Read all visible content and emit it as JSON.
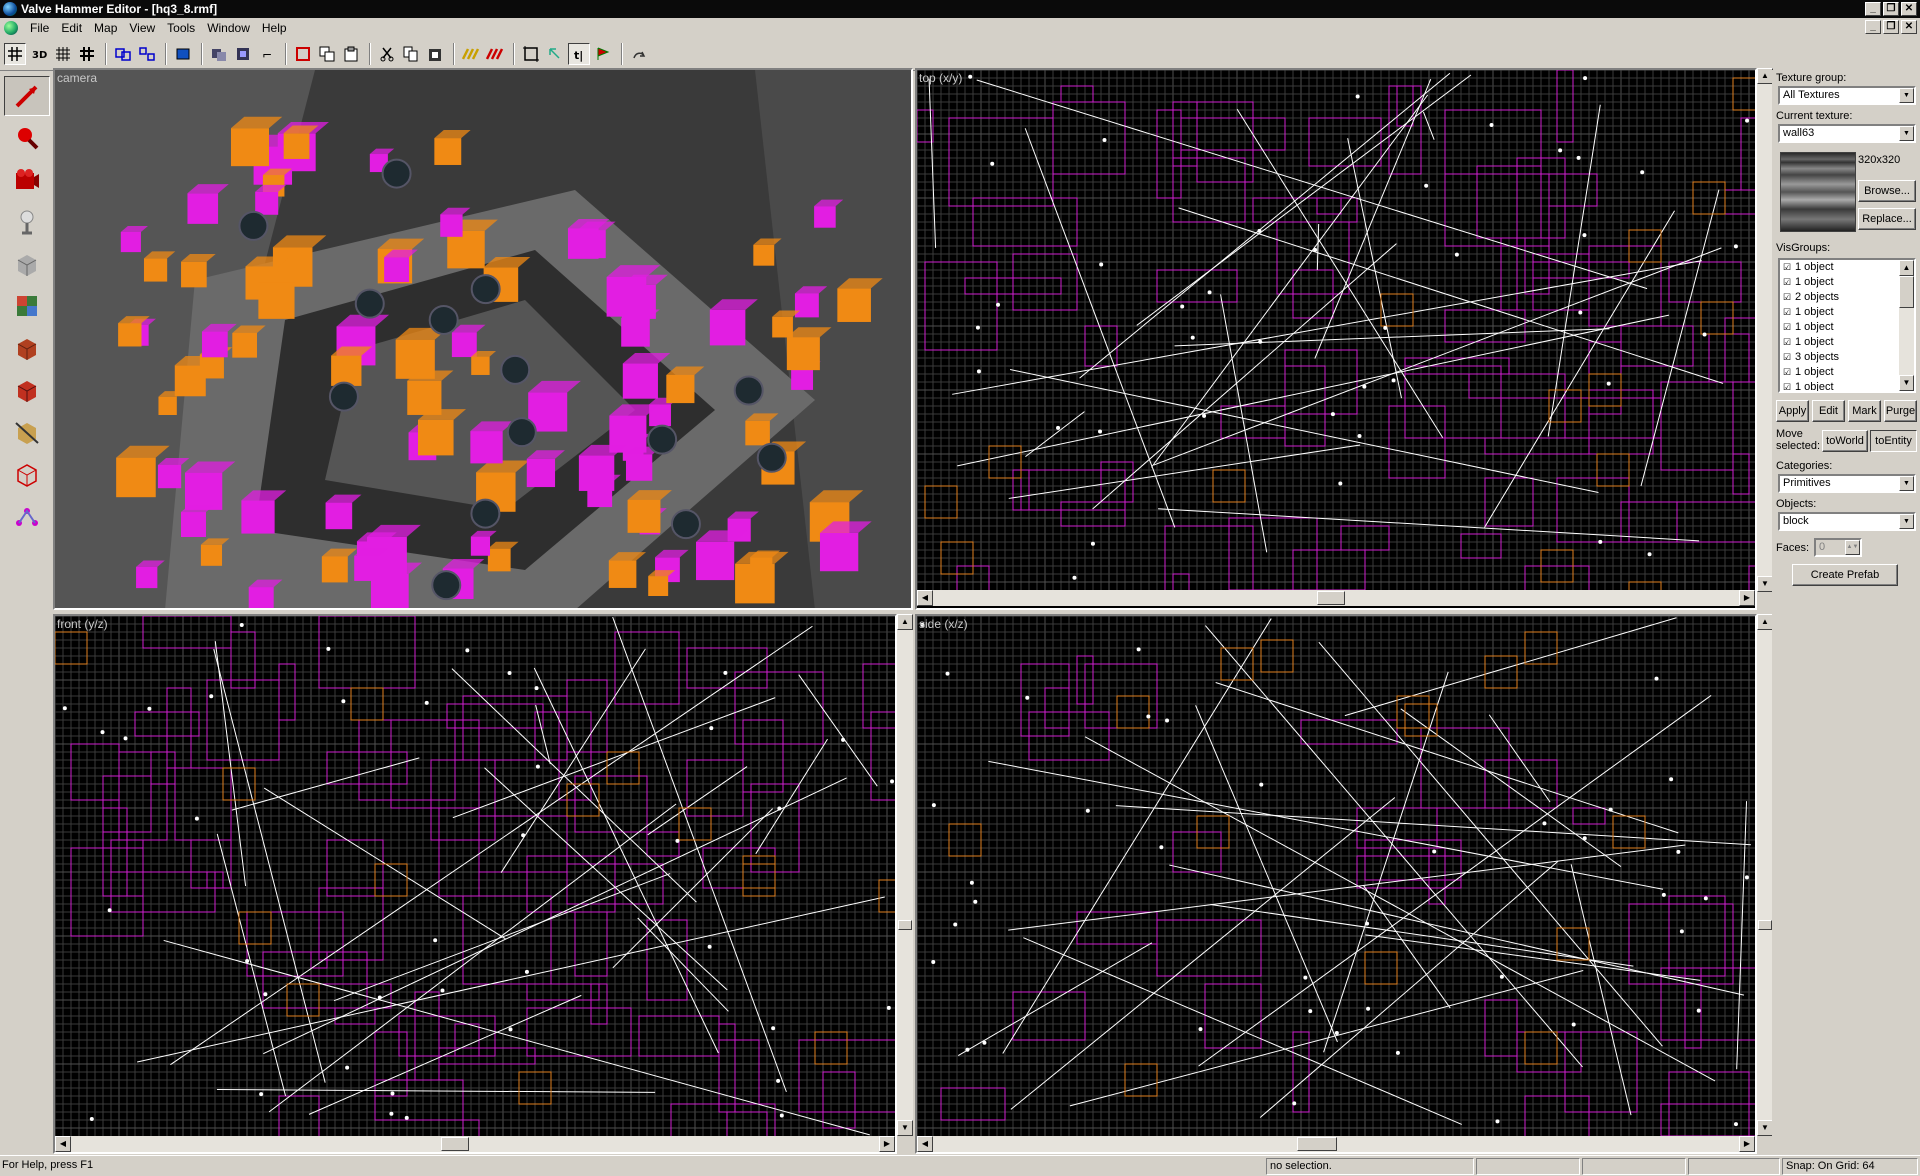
{
  "window": {
    "title": "Valve Hammer Editor - [hq3_8.rmf]",
    "minimize_glyph": "_",
    "restore_glyph": "❐",
    "close_glyph": "✕"
  },
  "menu": [
    "File",
    "Edit",
    "Map",
    "View",
    "Tools",
    "Window",
    "Help"
  ],
  "toolbar": {
    "buttons": [
      "grid-icon",
      "grid-3d-icon",
      "grid-size-icon",
      "grid-snap-icon",
      "group-icon",
      "ungroup-icon",
      "hide-icon",
      "carve-icon",
      "hollow-icon",
      "clip-icon",
      "texture-lock-icon",
      "cut-icon",
      "copy-icon",
      "paste-icon",
      "run-map-icon",
      "load-pointfile-icon",
      "texture-app-icon",
      "undo-icon",
      "redo-icon",
      "select-icon",
      "entity-report-icon",
      "toggle-3d-icon"
    ]
  },
  "left_tools": [
    "selection-tool-icon",
    "magnify-tool-icon",
    "camera-tool-icon",
    "entity-tool-icon",
    "block-tool-icon",
    "texture-tool-icon",
    "apply-texture-icon",
    "decal-tool-icon",
    "clipping-tool-icon",
    "vertex-tool-icon",
    "path-tool-icon"
  ],
  "viewports": {
    "camera": "camera",
    "top": "top (x/y)",
    "front": "front (y/z)",
    "side": "side (x/z)"
  },
  "panel": {
    "texture_group_label": "Texture group:",
    "texture_group_value": "All Textures",
    "current_texture_label": "Current texture:",
    "current_texture_value": "wall63",
    "texture_size": "320x320",
    "browse": "Browse...",
    "replace": "Replace...",
    "visgroups_label": "VisGroups:",
    "visgroups": [
      "1 object",
      "1 object",
      "2 objects",
      "1 object",
      "1 object",
      "1 object",
      "3 objects",
      "1 object",
      "1 object"
    ],
    "apply": "Apply",
    "edit": "Edit",
    "mark": "Mark",
    "purge": "Purge",
    "move_selected_label": "Move selected:",
    "to_world": "toWorld",
    "to_entity": "toEntity",
    "categories_label": "Categories:",
    "categories_value": "Primitives",
    "objects_label": "Objects:",
    "objects_value": "block",
    "faces_label": "Faces:",
    "faces_value": "0",
    "create_prefab": "Create Prefab"
  },
  "status": {
    "help": "For Help, press F1",
    "selection": "no selection.",
    "snap": "Snap: On Grid: 64"
  },
  "colors": {
    "brush": "#d020d0",
    "entity": "#e08020",
    "selected": "#ffffff",
    "grid": "#3a3a3a"
  }
}
